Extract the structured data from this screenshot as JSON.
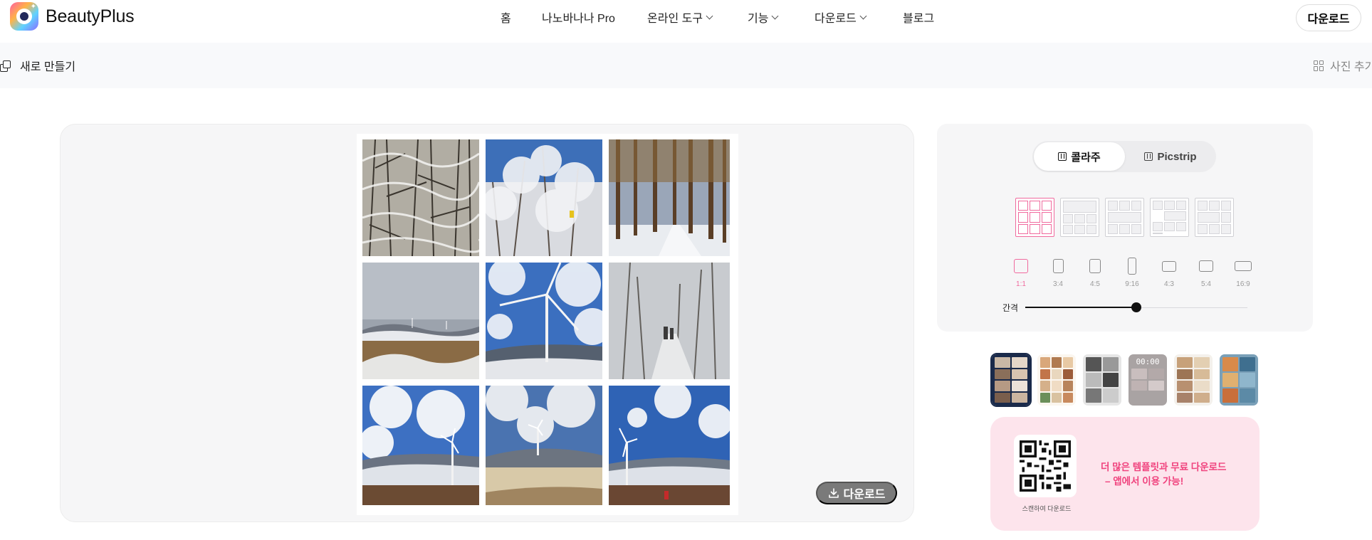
{
  "brand": {
    "name": "BeautyPlus"
  },
  "nav": {
    "items": [
      {
        "label": "홈",
        "dropdown": false
      },
      {
        "label": "나노바나나 Pro",
        "dropdown": false
      },
      {
        "label": "온라인 도구",
        "dropdown": true
      },
      {
        "label": "기능",
        "dropdown": true
      },
      {
        "label": "다운로드",
        "dropdown": true
      },
      {
        "label": "블로그",
        "dropdown": false
      }
    ],
    "download_button": "다운로드"
  },
  "toolbar": {
    "new_label": "새로 만들기",
    "add_photo_label": "사진 추가"
  },
  "canvas": {
    "download_label": "다운로드",
    "photos": [
      "snowy-forest-branches",
      "frosted-trees-blue-sky",
      "pine-forest-snow-path",
      "snowy-hills-wind-turbines",
      "wind-turbine-closeup",
      "foggy-snow-forest-hikers",
      "turbine-mountain-view",
      "turbine-on-snowy-ridge",
      "turbine-hiker-valley"
    ]
  },
  "panel": {
    "modes": [
      {
        "label": "콜라주",
        "active": true
      },
      {
        "label": "Picstrip",
        "active": false
      }
    ],
    "ratios": [
      "1:1",
      "3:4",
      "4:5",
      "9:16",
      "4:3",
      "5:4",
      "16:9"
    ],
    "active_ratio": "1:1",
    "gap_label": "간격",
    "gap_value": 0.5,
    "selected_layout": 0
  },
  "templates": {
    "time_badge": "00:00"
  },
  "promo": {
    "qr_caption": "스캔하여 다운로드",
    "line1": "더 많은 템플릿과 무료 다운로드",
    "line2": "– 앱에서 이용 가능!"
  },
  "colors": {
    "accent_pink": "#f06a9e",
    "promo_bg": "#fde4ec",
    "promo_text": "#f0437e"
  }
}
